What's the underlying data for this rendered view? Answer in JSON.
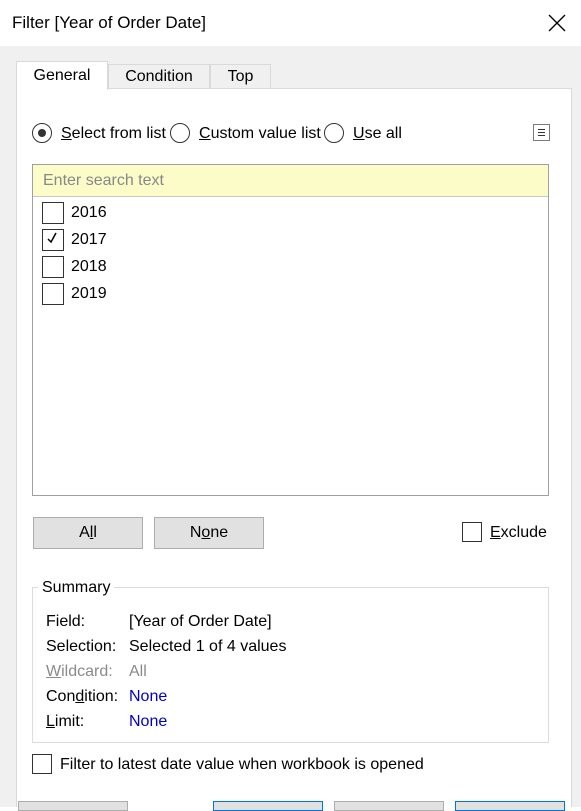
{
  "window": {
    "title": "Filter [Year of Order Date]"
  },
  "tabs": [
    {
      "label": "General",
      "active": true
    },
    {
      "label": "Condition",
      "active": false
    },
    {
      "label": "Top",
      "active": false
    }
  ],
  "mode_options": [
    {
      "mnemonic": "S",
      "rest": "elect from list",
      "checked": true
    },
    {
      "mnemonic": "C",
      "rest": "ustom value list",
      "checked": false
    },
    {
      "mnemonic": "U",
      "rest": "se all",
      "checked": false
    }
  ],
  "search": {
    "placeholder": "Enter search text",
    "value": ""
  },
  "values": [
    {
      "label": "2016",
      "checked": false
    },
    {
      "label": "2017",
      "checked": true
    },
    {
      "label": "2018",
      "checked": false
    },
    {
      "label": "2019",
      "checked": false
    }
  ],
  "buttons": {
    "all": {
      "pre": "A",
      "mnemonic": "l",
      "post": "l"
    },
    "none": {
      "pre": "N",
      "mnemonic": "o",
      "post": "ne"
    }
  },
  "exclude": {
    "mnemonic": "E",
    "rest": "xclude",
    "checked": false
  },
  "summary": {
    "title": "Summary",
    "field": {
      "label": "Field:",
      "value": "[Year of Order Date]"
    },
    "selection": {
      "label": "Selection:",
      "value": "Selected 1 of 4 values"
    },
    "wildcard": {
      "label_mnemonic": "W",
      "label_rest": "ildcard:",
      "value": "All"
    },
    "condition": {
      "label_pre": "Con",
      "label_mnemonic": "d",
      "label_post": "ition:",
      "value": "None"
    },
    "limit": {
      "label_mnemonic": "L",
      "label_rest": "imit:",
      "value": "None"
    }
  },
  "latest_date": {
    "label": "Filter to latest date value when workbook is opened",
    "checked": false
  },
  "colors": {
    "link": "#0000cc",
    "search_bg": "#fbfcc8",
    "disabled": "#8a8a8a",
    "primary_border": "#0078d7"
  }
}
